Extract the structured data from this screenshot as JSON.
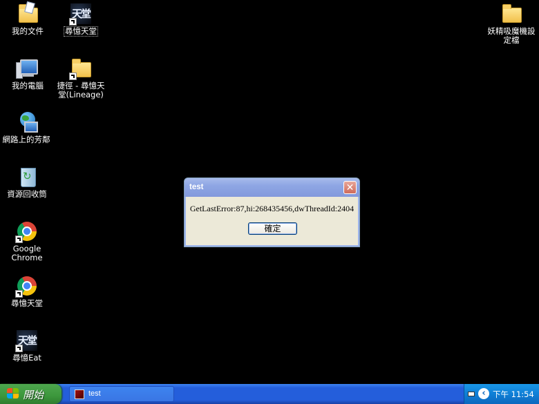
{
  "desktop": {
    "icons": [
      {
        "label": "我的文件"
      },
      {
        "label": "尋憶天堂"
      },
      {
        "label": "我的電腦"
      },
      {
        "label": "捷徑 - 尋憶天\n堂(Lineage)"
      },
      {
        "label": "網路上的芳鄰"
      },
      {
        "label": "資源回收筒"
      },
      {
        "label": "Google Chrome"
      },
      {
        "label": "尋憶天堂"
      },
      {
        "label": "尋憶Eat"
      },
      {
        "label": "妖精吸魔機設\n定檔"
      }
    ]
  },
  "dialog": {
    "title": "test",
    "close_glyph": "✕",
    "message": "GetLastError:87,hi:268435456,dwThreadId:2404",
    "ok_label": "確定"
  },
  "taskbar": {
    "start_label": "開始",
    "tasks": [
      {
        "label": "test"
      }
    ],
    "tray": {
      "chevron_glyph": "‹",
      "clock": "下午 11:54"
    }
  },
  "colors": {
    "desktop_bg": "#000000",
    "taskbar_blue": "#245edb",
    "start_green": "#3c973c",
    "tray_blue": "#0f7fd6",
    "dialog_face": "#ece9d8",
    "title_bar": "#8ea6e4"
  },
  "icons": {
    "my_documents": "folder-documents-icon",
    "lineage": "lineage-logo-icon",
    "my_computer": "computer-icon",
    "shortcut_folder": "folder-icon",
    "network": "network-globe-icon",
    "recycle_bin": "recycle-bin-icon",
    "chrome": "chrome-icon",
    "config_folder": "folder-icon"
  }
}
